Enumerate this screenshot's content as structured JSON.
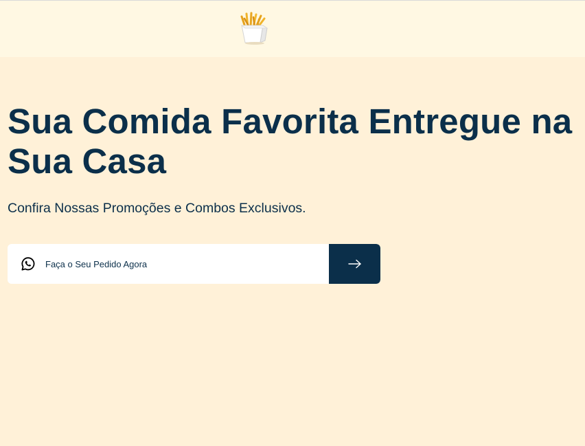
{
  "header": {
    "logo_icon": "french-fries-icon"
  },
  "hero": {
    "title": "Sua Comida Favorita Entregue na Sua Casa",
    "subtitle": "Confira Nossas Promoções e Combos Exclusivos."
  },
  "order": {
    "icon": "whatsapp-icon",
    "placeholder": "Faça o Seu Pedido Agora",
    "value": "",
    "submit_icon": "arrow-right-icon"
  },
  "colors": {
    "background": "#fff1d8",
    "header_background": "#fff8e3",
    "accent": "#0b2f4a",
    "input_background": "#ffffff"
  }
}
